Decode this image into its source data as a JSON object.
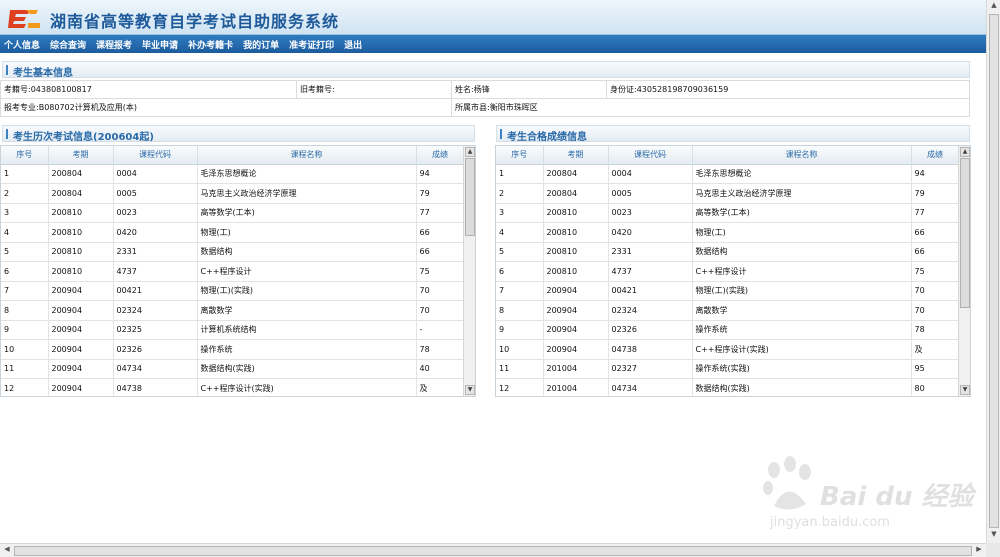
{
  "header": {
    "title": "湖南省高等教育自学考试自助服务系统",
    "logo_icon": "jiaoyu-logo-icon"
  },
  "nav": [
    "个人信息",
    "综合查询",
    "课程报考",
    "毕业申请",
    "补办考籍卡",
    "我的订单",
    "准考证打印",
    "退出"
  ],
  "basic_info": {
    "section_title": "考生基本信息",
    "exam_id_label": "考籍号:",
    "exam_id": "043808100817",
    "old_id_label": "旧考籍号:",
    "old_id": "",
    "name_label": "姓名:",
    "name": "杨锋",
    "id_card_label": "身份证:",
    "id_card": "430528198709036159",
    "major_label": "报考专业:",
    "major": "B080702计算机及应用(本)",
    "city_label": "所属市县:",
    "city": "衡阳市珠晖区"
  },
  "history": {
    "section_title": "考生历次考试信息(200604起)",
    "columns": [
      "序号",
      "考期",
      "课程代码",
      "课程名称",
      "成绩"
    ],
    "rows": [
      [
        "1",
        "200804",
        "0004",
        "毛泽东思想概论",
        "94"
      ],
      [
        "2",
        "200804",
        "0005",
        "马克思主义政治经济学原理",
        "79"
      ],
      [
        "3",
        "200810",
        "0023",
        "高等数学(工本)",
        "77"
      ],
      [
        "4",
        "200810",
        "0420",
        "物理(工)",
        "66"
      ],
      [
        "5",
        "200810",
        "2331",
        "数据结构",
        "66"
      ],
      [
        "6",
        "200810",
        "4737",
        "C++程序设计",
        "75"
      ],
      [
        "7",
        "200904",
        "00421",
        "物理(工)(实践)",
        "70"
      ],
      [
        "8",
        "200904",
        "02324",
        "离散数学",
        "70"
      ],
      [
        "9",
        "200904",
        "02325",
        "计算机系统结构",
        "-"
      ],
      [
        "10",
        "200904",
        "02326",
        "操作系统",
        "78"
      ],
      [
        "11",
        "200904",
        "04734",
        "数据结构(实践)",
        "40"
      ],
      [
        "12",
        "200904",
        "04738",
        "C++程序设计(实践)",
        "及"
      ]
    ]
  },
  "passed": {
    "section_title": "考生合格成绩信息",
    "columns": [
      "序号",
      "考期",
      "课程代码",
      "课程名称",
      "成绩"
    ],
    "rows": [
      [
        "1",
        "200804",
        "0004",
        "毛泽东思想概论",
        "94"
      ],
      [
        "2",
        "200804",
        "0005",
        "马克思主义政治经济学原理",
        "79"
      ],
      [
        "3",
        "200810",
        "0023",
        "高等数学(工本)",
        "77"
      ],
      [
        "4",
        "200810",
        "0420",
        "物理(工)",
        "66"
      ],
      [
        "5",
        "200810",
        "2331",
        "数据结构",
        "66"
      ],
      [
        "6",
        "200810",
        "4737",
        "C++程序设计",
        "75"
      ],
      [
        "7",
        "200904",
        "00421",
        "物理(工)(实践)",
        "70"
      ],
      [
        "8",
        "200904",
        "02324",
        "离散数学",
        "70"
      ],
      [
        "9",
        "200904",
        "02326",
        "操作系统",
        "78"
      ],
      [
        "10",
        "200904",
        "04738",
        "C++程序设计(实践)",
        "及"
      ],
      [
        "11",
        "201004",
        "02327",
        "操作系统(实践)",
        "95"
      ],
      [
        "12",
        "201004",
        "04734",
        "数据结构(实践)",
        "80"
      ]
    ]
  },
  "watermark": {
    "main": "Bai du 经验",
    "sub": "jingyan.baidu.com"
  },
  "colors": {
    "accent": "#1e5a9a",
    "nav_bg": "#1c5c9e",
    "section_text": "#2a6aa8"
  }
}
